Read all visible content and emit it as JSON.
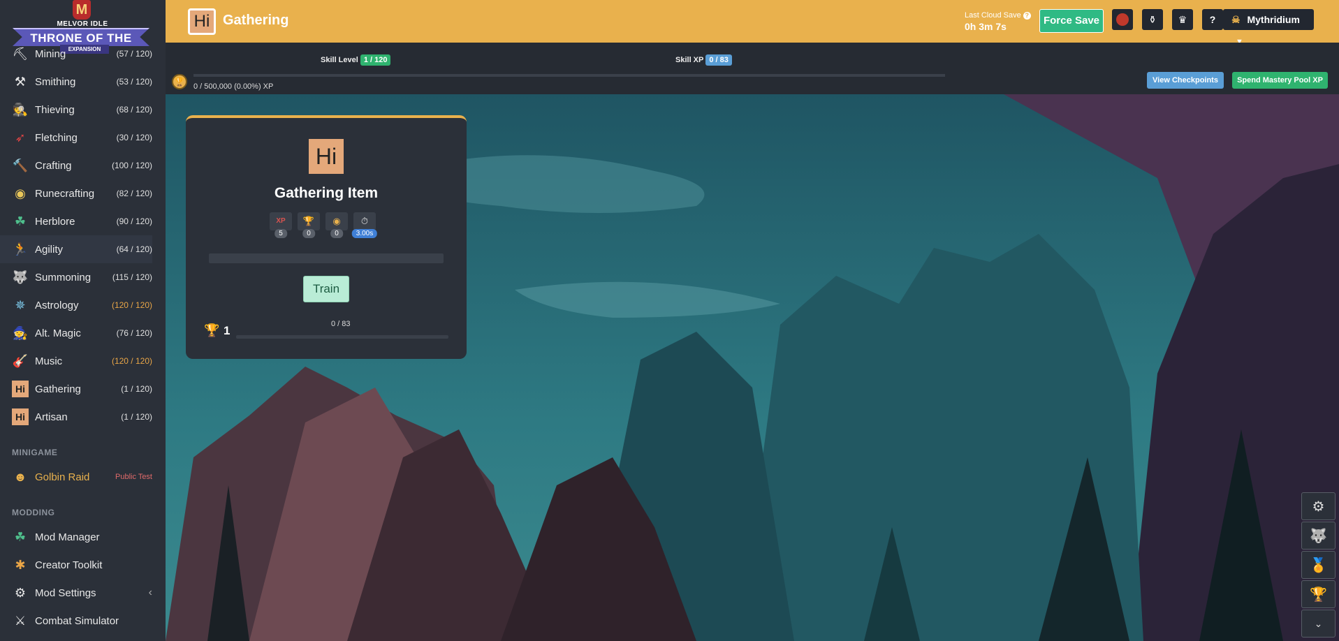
{
  "logo": {
    "brand": "MELVOR IDLE",
    "title": "THRONE OF THE HERALD",
    "subtitle": "EXPANSION",
    "crest": "M"
  },
  "sidebar": {
    "skills": [
      {
        "name": "Mining",
        "level": "(57 / 120)",
        "icon": "pickaxe-icon",
        "glyph": "⛏"
      },
      {
        "name": "Smithing",
        "level": "(53 / 120)",
        "icon": "anvil-icon",
        "glyph": "⚒"
      },
      {
        "name": "Thieving",
        "level": "(68 / 120)",
        "icon": "thief-icon",
        "glyph": "🕵"
      },
      {
        "name": "Fletching",
        "level": "(30 / 120)",
        "icon": "arrow-icon",
        "glyph": "➶"
      },
      {
        "name": "Crafting",
        "level": "(100 / 120)",
        "icon": "hammer-icon",
        "glyph": "🔨"
      },
      {
        "name": "Runecrafting",
        "level": "(82 / 120)",
        "icon": "rune-icon",
        "glyph": "◉"
      },
      {
        "name": "Herblore",
        "level": "(90 / 120)",
        "icon": "herb-icon",
        "glyph": "☘"
      },
      {
        "name": "Agility",
        "level": "(64 / 120)",
        "icon": "runner-icon",
        "glyph": "🏃"
      },
      {
        "name": "Summoning",
        "level": "(115 / 120)",
        "icon": "wolf-icon",
        "glyph": "🐺"
      },
      {
        "name": "Astrology",
        "level": "(120 / 120)",
        "icon": "star-wheel-icon",
        "glyph": "✵"
      },
      {
        "name": "Alt. Magic",
        "level": "(76 / 120)",
        "icon": "wizard-hat-icon",
        "glyph": "🧙"
      },
      {
        "name": "Music",
        "level": "(120 / 120)",
        "icon": "guitar-icon",
        "glyph": "🎸"
      },
      {
        "name": "Gathering",
        "level": "(1 / 120)",
        "icon": "hi-badge-icon",
        "glyph": "Hi"
      },
      {
        "name": "Artisan",
        "level": "(1 / 120)",
        "icon": "hi-badge-icon",
        "glyph": "Hi"
      }
    ],
    "minigame_header": "MINIGAME",
    "minigame": {
      "name": "Golbin Raid",
      "tag": "Public Test"
    },
    "modding_header": "MODDING",
    "modding": [
      {
        "name": "Mod Manager",
        "glyph": "☘"
      },
      {
        "name": "Creator Toolkit",
        "glyph": "✱"
      },
      {
        "name": "Mod Settings",
        "glyph": "⚙",
        "chevron": "‹"
      },
      {
        "name": "Combat Simulator",
        "glyph": "⚔"
      }
    ]
  },
  "topbar": {
    "page_icon": "Hi",
    "page_title": "Gathering",
    "cloud_label": "Last Cloud Save",
    "cloud_help": "?",
    "cloud_value": "0h 3m 7s",
    "force_save": "Force Save",
    "help": "?",
    "user": "Mythridium",
    "colors": {
      "accent": "#e9b14d",
      "green": "#2fba84"
    }
  },
  "skillbar": {
    "level_label": "Skill Level",
    "level_value": "1 / 120",
    "xp_label": "Skill XP",
    "xp_value": "0 / 83",
    "mastery_text": "0 / 500,000 (0.00%) XP",
    "view_checkpoints": "View Checkpoints",
    "spend_pool": "Spend Mastery Pool XP"
  },
  "card": {
    "icon": "Hi",
    "name": "Gathering Item",
    "stats": [
      {
        "label": "XP",
        "value": "5"
      },
      {
        "label": "🏆",
        "value": "0"
      },
      {
        "label": "◉",
        "value": "0"
      },
      {
        "label": "⏱",
        "value": "3.00s"
      }
    ],
    "train": "Train",
    "mastery_level": "1",
    "mastery_xp": "0 / 83"
  }
}
